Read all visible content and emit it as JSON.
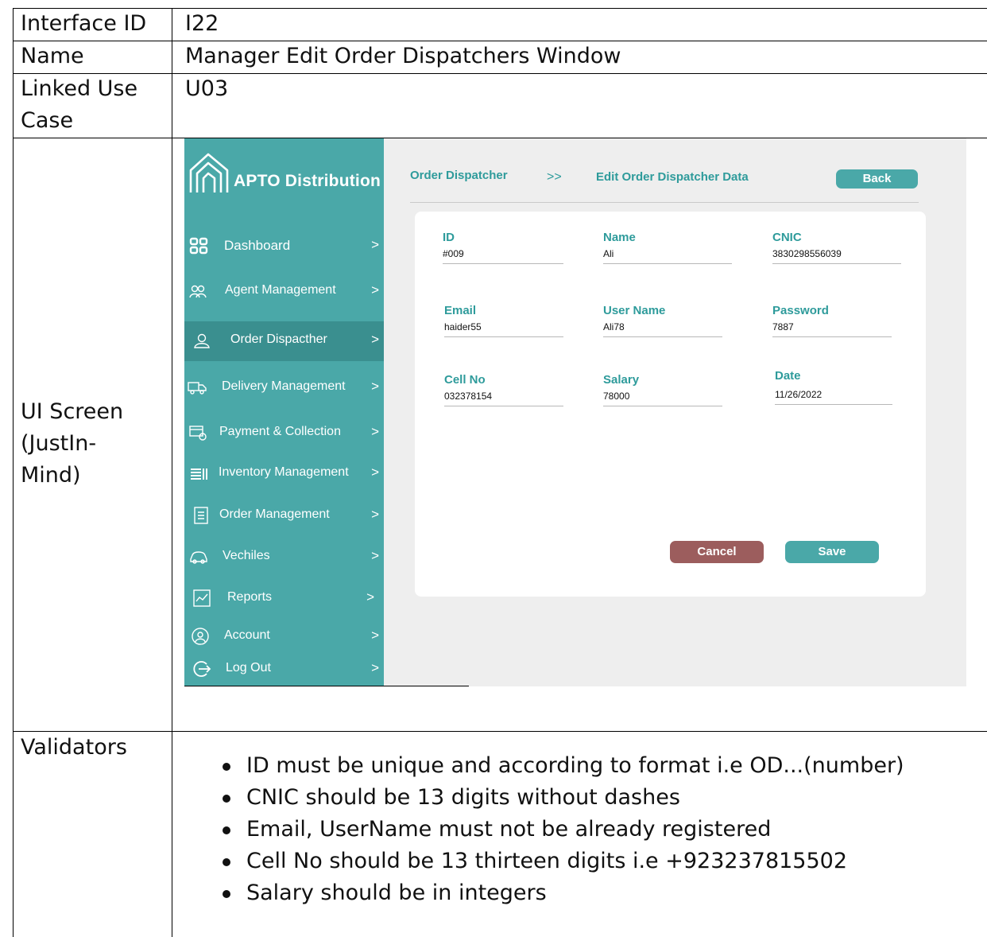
{
  "table": {
    "interface_id_label": "Interface ID",
    "interface_id_value": "I22",
    "name_label": "Name",
    "name_value": "Manager Edit Order Dispatchers Window",
    "linked_label_line1": "Linked Use",
    "linked_label_line2": "Case",
    "linked_value": "U03",
    "ui_screen_line1": "UI Screen",
    "ui_screen_line2": "(JustIn-",
    "ui_screen_line3": "Mind)",
    "validators_label": "Validators",
    "validators": [
      "ID must be unique and according to format i.e OD...(number)",
      "CNIC should be 13 digits without dashes",
      "Email, UserName must not be already registered",
      "Cell No should be 13 thirteen digits i.e +923237815502",
      "Salary should be in integers"
    ]
  },
  "app": {
    "brand": "APTO Distribution",
    "logo_icon": "house-outline-icon",
    "accent_color": "#4aa8a8",
    "sidebar": [
      {
        "label": "Dashboard",
        "icon": "grid-icon",
        "arrow": ">"
      },
      {
        "label": "Agent Management",
        "icon": "people-icon",
        "arrow": ">"
      },
      {
        "label": "Order Dispacther",
        "icon": "person-icon",
        "arrow": ">",
        "active": true
      },
      {
        "label": "Delivery Management",
        "icon": "truck-icon",
        "arrow": ">"
      },
      {
        "label": "Payment & Collection",
        "icon": "card-icon",
        "arrow": ">"
      },
      {
        "label": "Inventory Management",
        "icon": "inventory-icon",
        "arrow": ">"
      },
      {
        "label": "Order Management",
        "icon": "list-icon",
        "arrow": ">"
      },
      {
        "label": "Vechiles",
        "icon": "car-icon",
        "arrow": ">"
      },
      {
        "label": "Reports",
        "icon": "chart-icon",
        "arrow": ">"
      },
      {
        "label": "Account",
        "icon": "user-circle-icon",
        "arrow": ">"
      },
      {
        "label": "Log Out",
        "icon": "logout-icon",
        "arrow": ">"
      }
    ],
    "breadcrumb": {
      "parent": "Order Dispatcher",
      "separator": ">>",
      "current": "Edit Order Dispatcher Data"
    },
    "back_label": "Back",
    "form": {
      "id": {
        "label": "ID",
        "value": "#009"
      },
      "name": {
        "label": "Name",
        "value": "Ali"
      },
      "cnic": {
        "label": "CNIC",
        "value": "3830298556039"
      },
      "email": {
        "label": "Email",
        "value": "haider55"
      },
      "username": {
        "label": "User Name",
        "value": "Ali78"
      },
      "password": {
        "label": "Password",
        "value": "7887"
      },
      "cell": {
        "label": "Cell No",
        "value": "032378154"
      },
      "salary": {
        "label": "Salary",
        "value": "78000"
      },
      "date": {
        "label": "Date",
        "value": "11/26/2022"
      }
    },
    "cancel_label": "Cancel",
    "save_label": "Save"
  }
}
